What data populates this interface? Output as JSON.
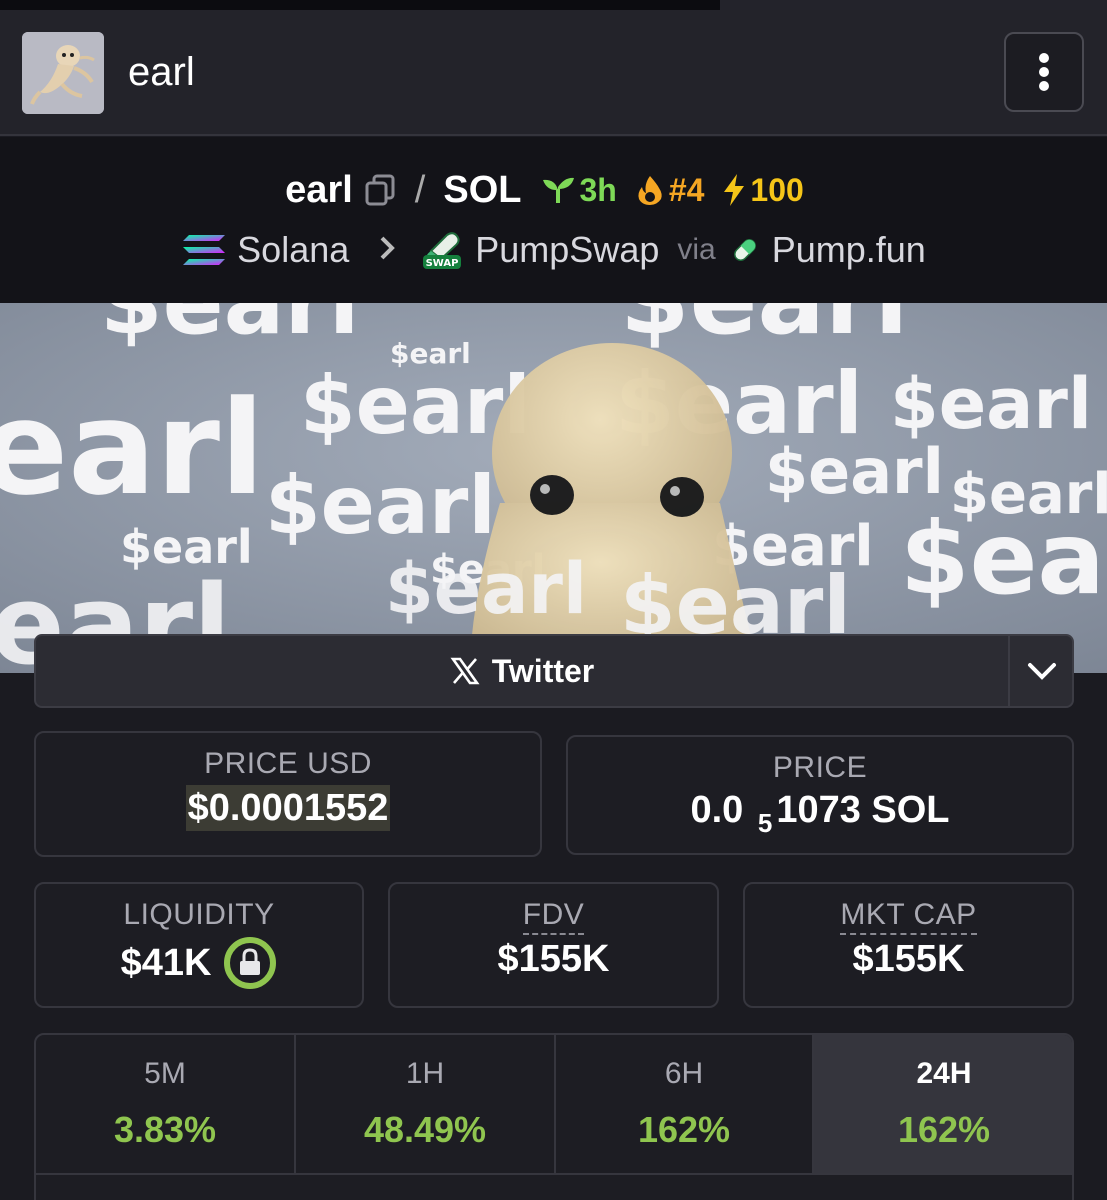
{
  "header": {
    "token_name": "earl"
  },
  "pair": {
    "base": "earl",
    "quote": "SOL",
    "age": "3h",
    "trending_rank": "#4",
    "boosts": "100",
    "chain": "Solana",
    "dex": "PumpSwap",
    "via_label": "via",
    "launchpad": "Pump.fun",
    "dex_badge": "SWAP"
  },
  "banner": {
    "words": [
      "$earl",
      "$earl",
      "$earl",
      "$earl",
      "$earl",
      "$earl",
      "$earl",
      "$earl",
      "$earl",
      "$earl",
      "earl",
      "$ea",
      "$earl",
      "$earl"
    ]
  },
  "socials": {
    "twitter_label": "Twitter"
  },
  "stats": {
    "price_usd_label": "PRICE USD",
    "price_usd": "$0.0001552",
    "price_label": "PRICE",
    "price_sol_prefix": "0.0",
    "price_sol_zeros": "5",
    "price_sol_suffix": "1073 SOL",
    "liquidity_label": "LIQUIDITY",
    "liquidity": "$41K",
    "fdv_label": "FDV",
    "fdv": "$155K",
    "mcap_label": "MKT CAP",
    "mcap": "$155K"
  },
  "changes": [
    {
      "label": "5M",
      "value": "3.83%"
    },
    {
      "label": "1H",
      "value": "48.49%"
    },
    {
      "label": "6H",
      "value": "162%"
    },
    {
      "label": "24H",
      "value": "162%"
    }
  ],
  "colors": {
    "positive": "#8fc54f",
    "age_green": "#7ed957",
    "rank_orange": "#f5a623",
    "boost_yellow": "#f5c518"
  }
}
